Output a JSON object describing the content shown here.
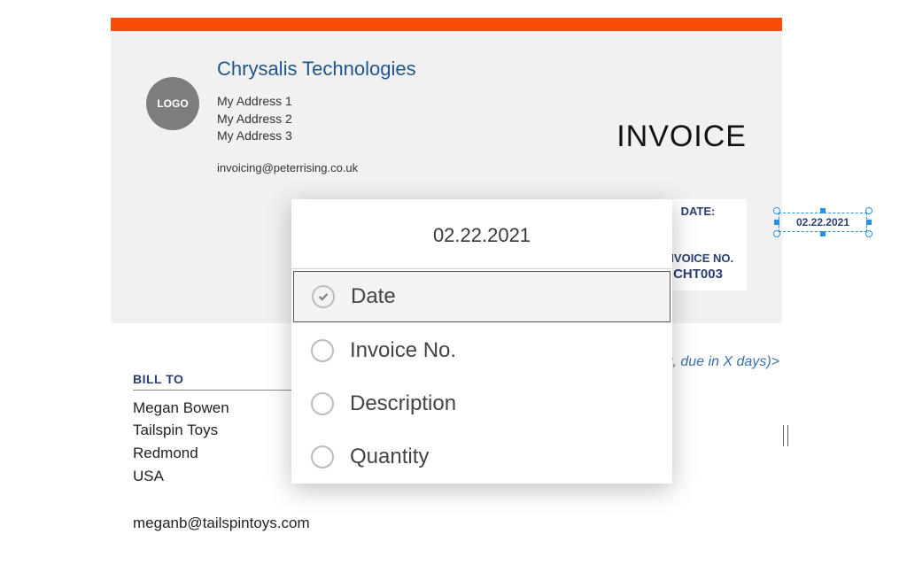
{
  "invoice": {
    "company_name": "Chrysalis Technologies",
    "logo_text": "LOGO",
    "address_1": "My Address 1",
    "address_2": "My Address 2",
    "address_3": "My Address 3",
    "email": "invoicing@peterrising.co.uk",
    "title": "INVOICE",
    "date_label": "DATE:",
    "date_value": "02.22.2021",
    "invoice_no_label": "INVOICE NO.",
    "invoice_no_value": "CHT003",
    "terms_placeholder": "pt, due in X days)>",
    "bill_to_label": "BILL TO",
    "bill_to": {
      "name": "Megan Bowen",
      "line1": "Tailspin Toys",
      "line2": "Redmond",
      "line3": "USA",
      "email": "meganb@tailspintoys.com"
    }
  },
  "popup": {
    "header": "02.22.2021",
    "options": {
      "date": "Date",
      "invoice_no": "Invoice No.",
      "description": "Description",
      "quantity": "Quantity"
    }
  }
}
